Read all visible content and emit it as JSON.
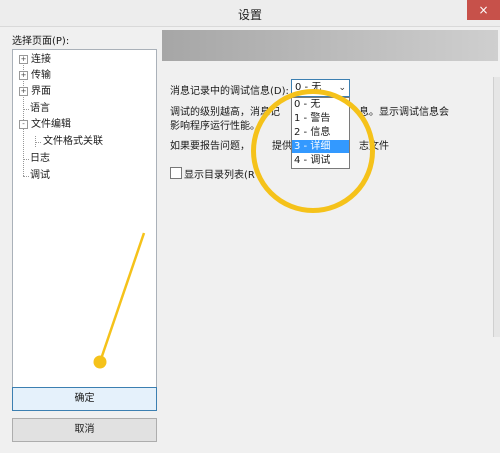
{
  "window": {
    "title": "设置",
    "close_icon": "×"
  },
  "left": {
    "select_label": "选择页面(P):",
    "tree": [
      {
        "label": "连接",
        "expander": "+"
      },
      {
        "label": "传输",
        "expander": "+"
      },
      {
        "label": "界面",
        "expander": "+"
      },
      {
        "label": "语言",
        "expander": ""
      },
      {
        "label": "文件编辑",
        "expander": "-"
      },
      {
        "label": "文件格式关联",
        "expander": ""
      },
      {
        "label": "日志",
        "expander": ""
      },
      {
        "label": "调试",
        "expander": ""
      }
    ],
    "ok_label": "确定",
    "cancel_label": "取消"
  },
  "right": {
    "debug_level_label": "消息记录中的调试信息(D):",
    "debug_level_value": "0 - 无",
    "dropdown_options": [
      "0 - 无",
      "1 - 警告",
      "2 - 信息",
      "3 - 详细",
      "4 - 调试"
    ],
    "selected_option_index": 3,
    "desc_line1_a": "调试的级别越高，消息记",
    "desc_line1_b": "息。显示调试信息会",
    "desc_line2": "影响程序运行性能。",
    "desc_line3_a": "如果要报告问题，",
    "desc_line3_b": "提供“详",
    "desc_line3_c": "志文件",
    "show_dir_list_label": "显示目录列表(R",
    "accent_color": "#f5c21a",
    "highlight_color": "#3399ff"
  }
}
